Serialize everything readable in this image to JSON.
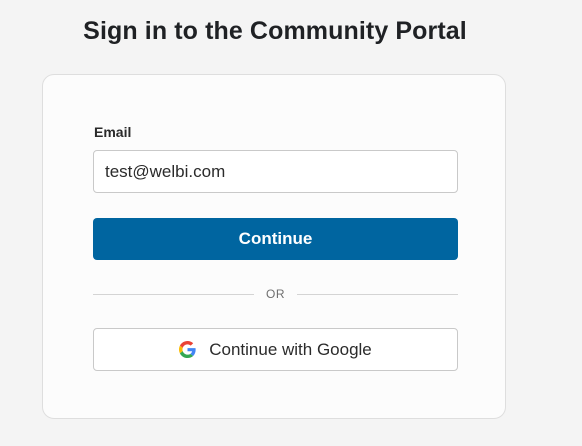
{
  "page": {
    "title": "Sign in to the Community Portal"
  },
  "form": {
    "email_label": "Email",
    "email_value": "test@welbi.com",
    "continue_label": "Continue",
    "divider_text": "OR",
    "google_label": "Continue with Google",
    "google_icon": "google-logo-icon"
  },
  "colors": {
    "primary": "#0065a0",
    "background": "#f4f4f4",
    "card": "#fcfcfc"
  }
}
